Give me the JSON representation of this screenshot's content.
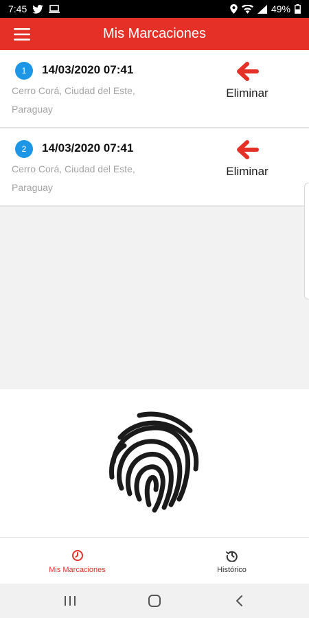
{
  "status_bar": {
    "time": "7:45",
    "battery": "49%"
  },
  "app_bar": {
    "title": "Mis Marcaciones"
  },
  "records": [
    {
      "number": "1",
      "datetime": "14/03/2020 07:41",
      "location": "Cerro Corá, Ciudad del Este, Paraguay",
      "delete_label": "Eliminar"
    },
    {
      "number": "2",
      "datetime": "14/03/2020 07:41",
      "location": "Cerro Corá, Ciudad del Este, Paraguay",
      "delete_label": "Eliminar"
    }
  ],
  "bottom_nav": [
    {
      "label": "Mis Marcaciones",
      "icon": "clock-icon",
      "active": true
    },
    {
      "label": "Histórico",
      "icon": "history-icon",
      "active": false
    }
  ],
  "colors": {
    "primary": "#e53027",
    "badge": "#1e96e6",
    "inactive": "#333333"
  }
}
